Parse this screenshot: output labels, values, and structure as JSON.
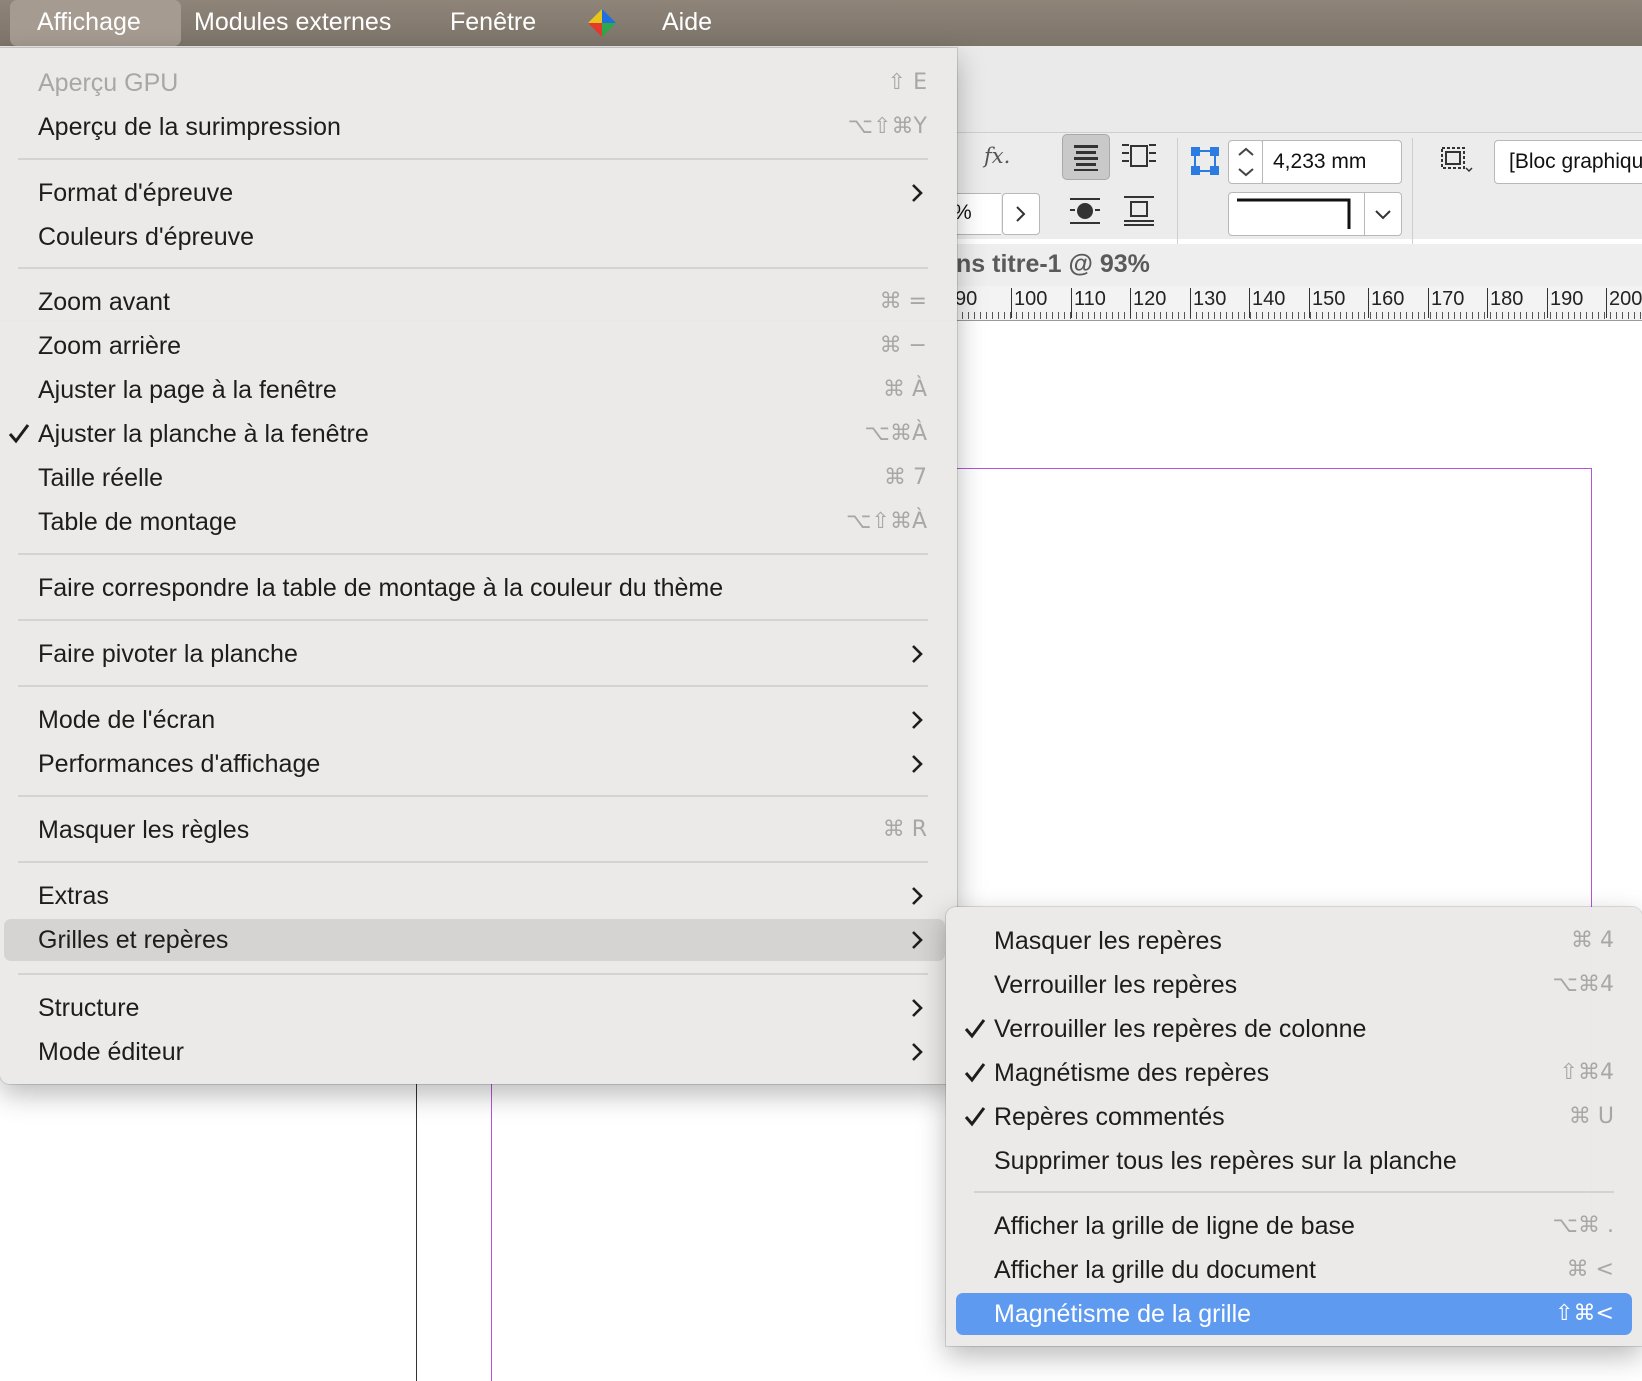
{
  "menubar": {
    "items": [
      "Affichage",
      "Modules externes",
      "Fenêtre",
      "Aide"
    ]
  },
  "toolbar": {
    "offset_value": "4,233 mm",
    "frame_type": "[Bloc graphiqu",
    "percent_fragment": "%",
    "fx_label": "fx."
  },
  "document": {
    "title": "ns titre-1 @ 93%",
    "ruler_labels": [
      "90",
      "100",
      "110",
      "120",
      "130",
      "140",
      "150",
      "160",
      "170",
      "180",
      "190",
      "200"
    ]
  },
  "main_menu": {
    "items": [
      {
        "label": "Aperçu GPU",
        "shortcut": "⇧ E",
        "disabled": true
      },
      {
        "label": "Aperçu de la surimpression",
        "shortcut": "⌥⇧⌘Y"
      },
      {
        "label": "Format d'épreuve",
        "submenu": true
      },
      {
        "label": "Couleurs d'épreuve"
      },
      {
        "label": "Zoom avant",
        "shortcut": "⌘ ="
      },
      {
        "label": "Zoom arrière",
        "shortcut": "⌘ −"
      },
      {
        "label": "Ajuster la page à la fenêtre",
        "shortcut": "⌘ À"
      },
      {
        "label": "Ajuster la planche à la fenêtre",
        "shortcut": "⌥⌘À",
        "checked": true
      },
      {
        "label": "Taille réelle",
        "shortcut": "⌘ 7"
      },
      {
        "label": "Table de montage",
        "shortcut": "⌥⇧⌘À"
      },
      {
        "label": "Faire correspondre la table de montage à la couleur du thème"
      },
      {
        "label": "Faire pivoter la planche",
        "submenu": true
      },
      {
        "label": "Mode de l'écran",
        "submenu": true
      },
      {
        "label": "Performances d'affichage",
        "submenu": true
      },
      {
        "label": "Masquer les règles",
        "shortcut": "⌘ R"
      },
      {
        "label": "Extras",
        "submenu": true
      },
      {
        "label": "Grilles et repères",
        "submenu": true,
        "highlighted": true
      },
      {
        "label": "Structure",
        "submenu": true
      },
      {
        "label": "Mode éditeur",
        "submenu": true
      }
    ]
  },
  "sub_menu": {
    "items": [
      {
        "label": "Masquer les repères",
        "shortcut": "⌘ 4"
      },
      {
        "label": "Verrouiller les repères",
        "shortcut": "⌥⌘4"
      },
      {
        "label": "Verrouiller les repères de colonne",
        "checked": true
      },
      {
        "label": "Magnétisme des repères",
        "shortcut": "⇧⌘4",
        "checked": true
      },
      {
        "label": "Repères commentés",
        "shortcut": "⌘ U",
        "checked": true
      },
      {
        "label": "Supprimer tous les repères sur la planche"
      },
      {
        "label": "Afficher la grille de ligne de base",
        "shortcut": "⌥⌘ ."
      },
      {
        "label": "Afficher la grille du document",
        "shortcut": "⌘ <"
      },
      {
        "label": "Magnétisme de la grille",
        "shortcut": "⇧⌘<",
        "selected": true
      }
    ]
  },
  "colors": {
    "selection": "#5e9bf0",
    "guide_purple": "#b455d6",
    "menubar": "#857b70"
  }
}
